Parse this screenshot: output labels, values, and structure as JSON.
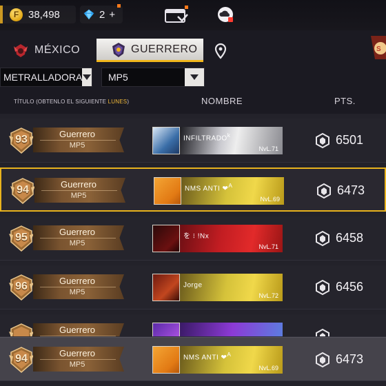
{
  "currency": {
    "coins": "38,498",
    "diamonds": "2",
    "diamonds_add": "+"
  },
  "tabs": [
    {
      "label": "MÉXICO",
      "active": false
    },
    {
      "label": "GUERRERO",
      "active": true
    }
  ],
  "filters": {
    "weapon_type": "METRALLADORA",
    "weapon": "MP5"
  },
  "columns": {
    "title_prefix": "TÍTULO (OBTENLO EL SIGUIENTE ",
    "title_highlight": "LUNES",
    "title_suffix": ")",
    "name": "NOMBRE",
    "pts": "PTS."
  },
  "rows": [
    {
      "rank": "93",
      "title": "Guerrero",
      "weapon": "MP5",
      "player": "INFILTRADO",
      "player_suffix": "k",
      "level": "NvL.71",
      "pts": "6501",
      "banner": "dark"
    },
    {
      "rank": "94",
      "title": "Guerrero",
      "weapon": "MP5",
      "player": "NMS   ANTI  ❤",
      "player_suffix": "A",
      "level": "NvL.69",
      "pts": "6473",
      "banner": "gold"
    },
    {
      "rank": "95",
      "title": "Guerrero",
      "weapon": "MP5",
      "player": "を  ⁝ !Nx",
      "player_suffix": "",
      "level": "NvL.71",
      "pts": "6458",
      "banner": "red"
    },
    {
      "rank": "96",
      "title": "Guerrero",
      "weapon": "MP5",
      "player": "Jorge",
      "player_suffix": "",
      "level": "NvL.72",
      "pts": "6456",
      "banner": "gold"
    },
    {
      "rank": "",
      "title": "Guerrero",
      "weapon": "",
      "player": "",
      "player_suffix": "",
      "level": "",
      "pts": "",
      "banner": "purple"
    },
    {
      "rank": "94",
      "title": "Guerrero",
      "weapon": "MP5",
      "player": "NMS   ANTI  ❤",
      "player_suffix": "A",
      "level": "NvL.69",
      "pts": "6473",
      "banner": "gold"
    }
  ],
  "colors": {
    "accent": "#f2b71c",
    "row_bg": "#25242c",
    "highlight_border": "#e9b31d"
  },
  "icons": [
    "coin-icon",
    "diamond-icon",
    "wallet-icon",
    "cloud-icon",
    "location-pin-icon",
    "rank-badge-icon",
    "points-emblem-icon"
  ]
}
